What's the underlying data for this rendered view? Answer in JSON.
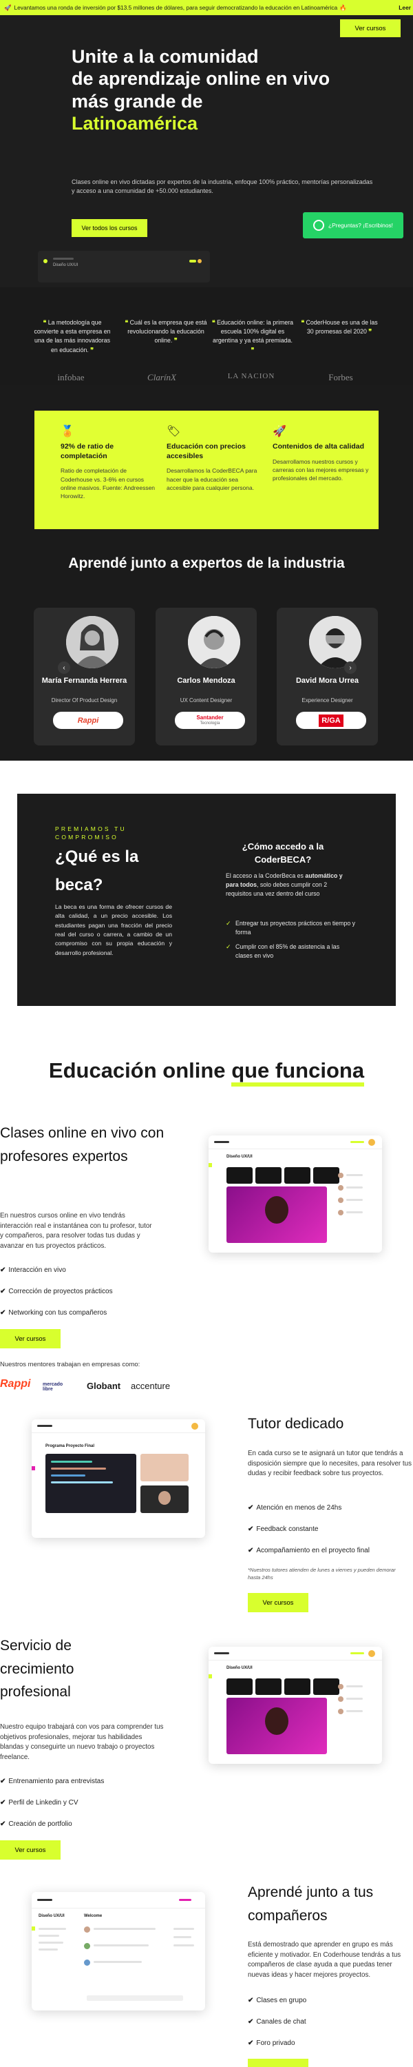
{
  "banner": {
    "rocket_icon": "rocket-icon",
    "text": "Levantamos una ronda de inversión por $13.5 millones de dólares, para seguir democratizando la educación en Latinoamérica",
    "fire_icon": "fire-icon",
    "link": "Leer"
  },
  "hero": {
    "cta_top": "Ver cursos",
    "title_line1": "Unite a la comunidad",
    "title_line2": "de aprendizaje online en vivo",
    "title_line3": "más grande de",
    "title_highlight": "Latinoamérica",
    "description": "Clases online en vivo dictadas por expertos de la industria, enfoque 100% práctico, mentorías personalizadas y acceso a una comunidad de +50.000 estudiantes.",
    "courses_button": "Ver todos los cursos",
    "whatsapp_button": "¿Preguntas? ¡Escribinos!",
    "mock_text": "Diseño UX/UI"
  },
  "press": {
    "quotes": [
      {
        "text": "La metodología que convierte a esta empresa en una de las más innovadoras en educación.",
        "logo": "infobae"
      },
      {
        "text": "Cuál es la empresa que está revolucionando la educación online.",
        "logo": "ClarínX"
      },
      {
        "text": "Educación online: la primera escuela 100% digital es argentina y ya está premiada.",
        "logo": "LA NACION"
      },
      {
        "text": "CoderHouse es una de las 30 promesas del 2020",
        "logo": "Forbes"
      }
    ],
    "quote_open": "❝",
    "quote_close": "❞"
  },
  "stats": [
    {
      "icon": "medal-icon",
      "title": "92% de ratio de completación",
      "desc": "Ratio de completación de Coderhouse vs. 3-6% en cursos online masivos. Fuente: Andreessen Horowitz."
    },
    {
      "icon": "tag-icon",
      "title": "Educación con precios accesibles",
      "desc": "Desarrollamos la CoderBECA para hacer que la educación sea accesible para cualquier persona."
    },
    {
      "icon": "rocket-icon",
      "title": "Contenidos de alta calidad",
      "desc": "Desarrollamos nuestros cursos y carreras con las mejores empresas y profesionales del mercado."
    }
  ],
  "experts": {
    "title": "Aprendé junto a expertos de la industria",
    "cards": [
      {
        "name": "María Fernanda Herrera",
        "role": "Director Of Product Design",
        "company": "Rappi",
        "company_color": "#e5402a"
      },
      {
        "name": "Carlos Mendoza",
        "role": "UX Content Designer",
        "company": "Santander",
        "company_color": "#e2001a",
        "company_tag": "Tecnología"
      },
      {
        "name": "David Mora Urrea",
        "role": "Experience Designer",
        "company": "R/GA",
        "company_color": "#e1001a"
      }
    ],
    "arrow_left": "‹",
    "arrow_right": "›"
  },
  "beca": {
    "eyebrow": "PREMIAMOS TU COMPROMISO",
    "title": "¿Qué es la beca?",
    "description": "La beca es una forma de ofrecer cursos de alta calidad, a un precio accesible. Los estudiantes pagan una fracción del precio real del curso o carrera, a cambio de un compromiso con su propia educación y desarrollo profesional.",
    "question": "¿Cómo accedo a la CoderBECA?",
    "answer_prefix": "El acceso a la CoderBeca es",
    "answer_bold": "automático y para todos",
    "answer_suffix": ", solo debes cumplir con 2 requisitos una vez dentro del curso",
    "requirements": [
      "Entregar tus proyectos prácticos en tiempo y forma",
      "Cumplir con el 85% de asistencia a las clases en vivo"
    ],
    "check": "✓"
  },
  "education": {
    "title_prefix": "Educación online",
    "title_underlined": "que funciona",
    "check": "✔",
    "block1": {
      "title": "Clases online en vivo con profesores expertos",
      "desc": "En nuestros cursos online en vivo tendrás interacción real e instantánea con tu profesor, tutor y compañeros, para resolver todas tus dudas y avanzar en tus proyectos prácticos.",
      "features": [
        "Interacción en vivo",
        "Corrección de proyectos prácticos",
        "Networking con tus compañeros"
      ],
      "button": "Ver cursos",
      "mock_title": "Diseño UX/UI"
    },
    "mentors_line": "Nuestros mentores trabajan en empresas como:",
    "mentor_companies": [
      {
        "name": "Rappi",
        "color": "#ff441f"
      },
      {
        "name": "mercado libre",
        "color": "#2d3277"
      },
      {
        "name": "Globant",
        "color": "#111111"
      },
      {
        "name": "accenture",
        "color": "#111111"
      }
    ],
    "block2": {
      "title": "Tutor dedicado",
      "desc": "En cada curso se te asignará un tutor que tendrás a disposición siempre que lo necesites, para resolver tus dudas y recibir feedback sobre tus proyectos.",
      "features": [
        "Atención en menos de 24hs",
        "Feedback constante",
        "Acompañamiento en el proyecto final"
      ],
      "note": "*Nuestros tutores atienden de lunes a viernes y pueden demorar hasta 24hs",
      "button": "Ver cursos",
      "mock_title": "Programa Proyecto Final"
    },
    "block3": {
      "title": "Servicio de crecimiento profesional",
      "desc": "Nuestro equipo trabajará con vos para comprender tus objetivos profesionales, mejorar tus habilidades blandas y conseguirte un nuevo trabajo o proyectos freelance.",
      "features": [
        "Entrenamiento para entrevistas",
        "Perfil de Linkedin y CV",
        "Creación de portfolio"
      ],
      "button": "Ver cursos",
      "mock_title": "Diseño UX/UI"
    },
    "block4": {
      "title": "Aprendé junto a tus compañeros",
      "desc": "Está demostrado que aprender en grupo es más eficiente y motivador. En Coderhouse tendrás a tus compañeros de clase ayuda a que puedas tener nuevas ideas y hacer mejores proyectos.",
      "features": [
        "Clases en grupo",
        "Canales de chat",
        "Foro privado"
      ],
      "mock_title": "Diseño UX/UI",
      "mock_channel": "Welcome"
    }
  }
}
